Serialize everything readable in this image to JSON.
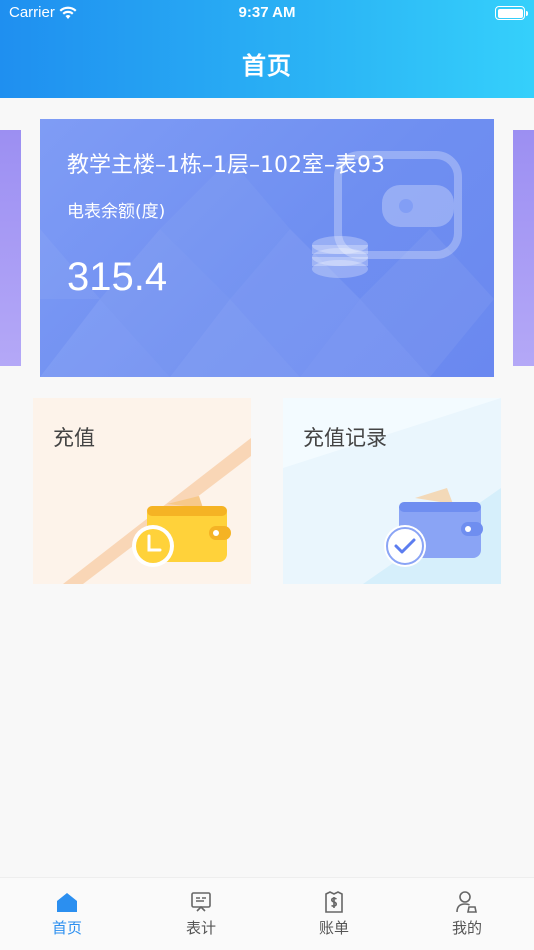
{
  "status_bar": {
    "carrier": "Carrier",
    "time": "9:37 AM"
  },
  "header": {
    "title": "首页"
  },
  "meter": {
    "name": "教学主楼–1栋–1层–102室–表93",
    "balance_label": "电表余额(度)",
    "balance_value": "315.4"
  },
  "actions": {
    "recharge_label": "充值",
    "records_label": "充值记录"
  },
  "tabs": [
    {
      "label": "首页",
      "icon": "home-icon",
      "active": true
    },
    {
      "label": "表计",
      "icon": "meter-icon",
      "active": false
    },
    {
      "label": "账单",
      "icon": "bill-icon",
      "active": false
    },
    {
      "label": "我的",
      "icon": "profile-icon",
      "active": false
    }
  ],
  "colors": {
    "accent": "#2b8ff0",
    "header_start": "#1f8ff0",
    "header_end": "#35d0fb",
    "card_blue": "#6f8ff1"
  }
}
